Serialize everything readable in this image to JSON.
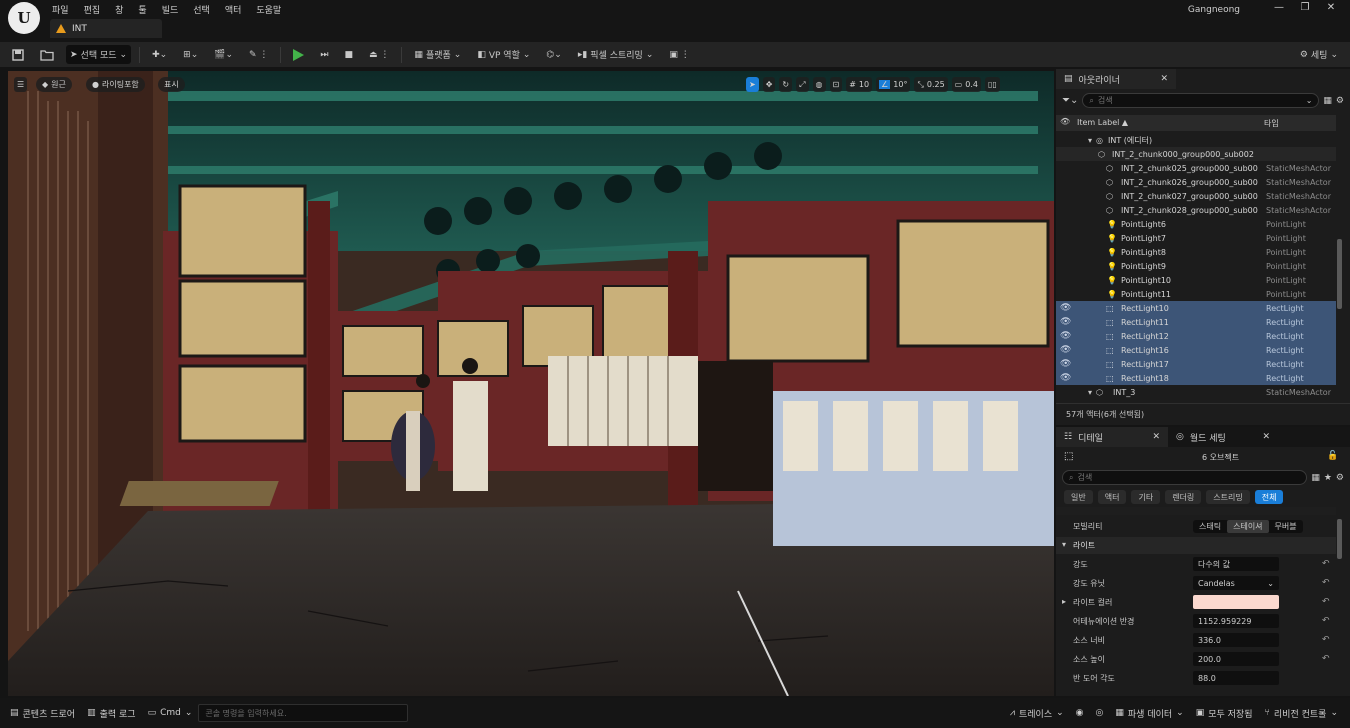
{
  "app": {
    "logo": "U",
    "menu": [
      "파일",
      "편집",
      "창",
      "툴",
      "빌드",
      "선택",
      "액터",
      "도움말"
    ],
    "project_name": "Gangneong",
    "level_tab": "INT",
    "window_controls": [
      "—",
      "❐",
      "✕"
    ]
  },
  "toolbar": {
    "select_mode": "선택 모드",
    "platforms": "플랫폼",
    "vp_role": "VP 역할",
    "pixel_streaming": "픽셀 스트리밍",
    "settings": "세팅"
  },
  "viewport": {
    "perspective": "원근",
    "lighting": "라이팅포함",
    "show": "표시",
    "grid_snap": "10",
    "angle_snap": "10°",
    "scale_snap": "0.25",
    "camera_speed": "0.4"
  },
  "outliner": {
    "tab": "아웃라이너",
    "search_placeholder": "검색",
    "col_label": "Item Label ▲",
    "col_type": "타입",
    "rows": [
      {
        "name": "INT (에디터)",
        "type": "",
        "selected": false
      },
      {
        "name": "INT_2_chunk000_group000_sub002",
        "type": "",
        "selected": false
      },
      {
        "name": "INT_2_chunk025_group000_sub00",
        "type": "StaticMeshActor",
        "selected": false
      },
      {
        "name": "INT_2_chunk026_group000_sub00",
        "type": "StaticMeshActor",
        "selected": false
      },
      {
        "name": "INT_2_chunk027_group000_sub00",
        "type": "StaticMeshActor",
        "selected": false
      },
      {
        "name": "INT_2_chunk028_group000_sub00",
        "type": "StaticMeshActor",
        "selected": false
      },
      {
        "name": "PointLight6",
        "type": "PointLight",
        "selected": false
      },
      {
        "name": "PointLight7",
        "type": "PointLight",
        "selected": false
      },
      {
        "name": "PointLight8",
        "type": "PointLight",
        "selected": false
      },
      {
        "name": "PointLight9",
        "type": "PointLight",
        "selected": false
      },
      {
        "name": "PointLight10",
        "type": "PointLight",
        "selected": false
      },
      {
        "name": "PointLight11",
        "type": "PointLight",
        "selected": false
      },
      {
        "name": "RectLight10",
        "type": "RectLight",
        "selected": true
      },
      {
        "name": "RectLight11",
        "type": "RectLight",
        "selected": true
      },
      {
        "name": "RectLight12",
        "type": "RectLight",
        "selected": true
      },
      {
        "name": "RectLight16",
        "type": "RectLight",
        "selected": true
      },
      {
        "name": "RectLight17",
        "type": "RectLight",
        "selected": true
      },
      {
        "name": "RectLight18",
        "type": "RectLight",
        "selected": true
      },
      {
        "name": "INT_3",
        "type": "StaticMeshActor",
        "selected": false
      }
    ],
    "footer": "57개 액터(6개 선택됨)"
  },
  "details": {
    "tab": "디테일",
    "world_tab": "월드 세팅",
    "object_count": "6 오브젝트",
    "search_placeholder": "검색",
    "filters": [
      "일반",
      "액터",
      "기타",
      "렌더링",
      "스트리밍",
      "전체"
    ],
    "active_filter": "전체",
    "mobility_label": "모빌리티",
    "mobility_options": [
      "스태틱",
      "스테이셔",
      "무버블"
    ],
    "active_mobility": "스테이셔",
    "section_light": "라이트",
    "props": [
      {
        "label": "강도",
        "value": "다수의 값"
      },
      {
        "label": "강도 유닛",
        "value": "Candelas"
      },
      {
        "label": "라이트 컬러",
        "value": ""
      },
      {
        "label": "어테뉴에이션 반경",
        "value": "1152.959229"
      },
      {
        "label": "소스 너비",
        "value": "336.0"
      },
      {
        "label": "소스 높이",
        "value": "200.0"
      },
      {
        "label": "반 도어 각도",
        "value": "88.0"
      }
    ],
    "light_color_hex": "#fbd9cf"
  },
  "statusbar": {
    "content_drawer": "콘텐츠 드로어",
    "output_log": "출력 로그",
    "cmd": "Cmd",
    "console_placeholder": "콘솔 명령을 입력하세요.",
    "trace": "트레이스",
    "derived_data": "파생 데이터",
    "save_all": "모두 저장됨",
    "revision_control": "리비전 컨트롤"
  },
  "colors": {
    "accent": "#1a7ed8",
    "selection": "#3d5577",
    "play": "#43b34a",
    "warning": "#e89b1c"
  }
}
